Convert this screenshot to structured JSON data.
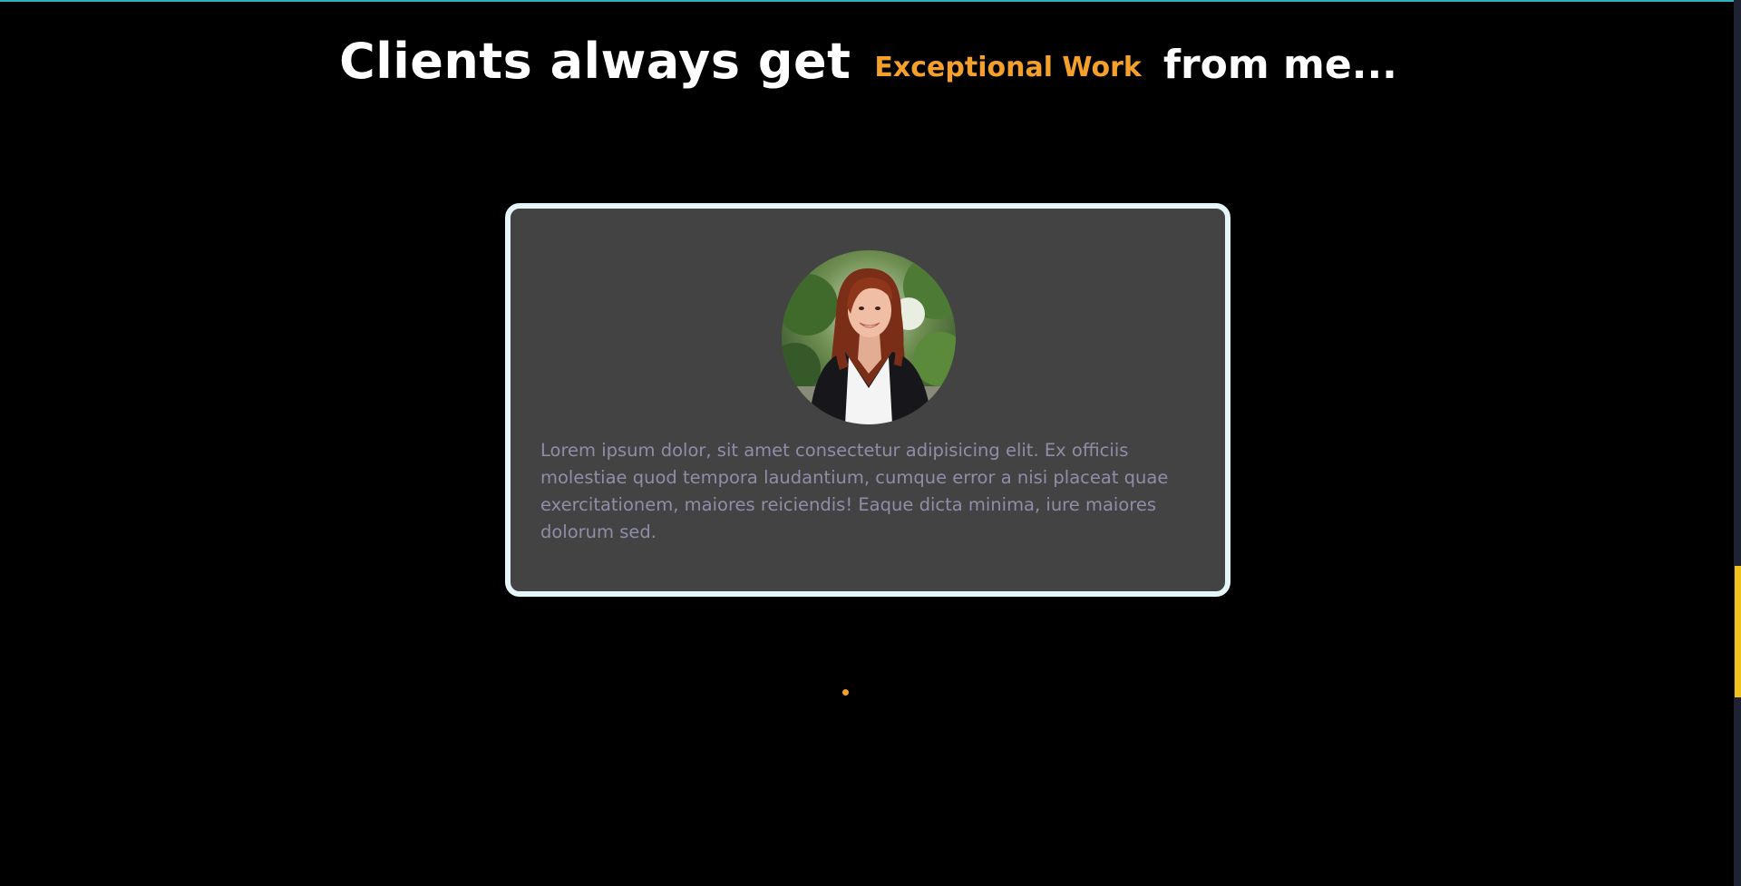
{
  "heading": {
    "part1": "Clients always get",
    "accent": "Exceptional Work",
    "part2": "from me..."
  },
  "testimonial": {
    "text": "Lorem ipsum dolor, sit amet consectetur adipisicing elit. Ex officiis molestiae quod tempora laudantium, cumque error a nisi placeat quae exercitationem, maiores reiciendis! Eaque dicta minima, iure maiores dolorum sed."
  },
  "colors": {
    "background": "#000000",
    "accent": "#f5a02a",
    "card_background": "#434343",
    "card_border": "#e4f6fa",
    "quote_text": "#8f8ea8",
    "scroll_thumb": "#f1c21b"
  },
  "carousel": {
    "total_slides": 1,
    "active_slide": 1
  }
}
